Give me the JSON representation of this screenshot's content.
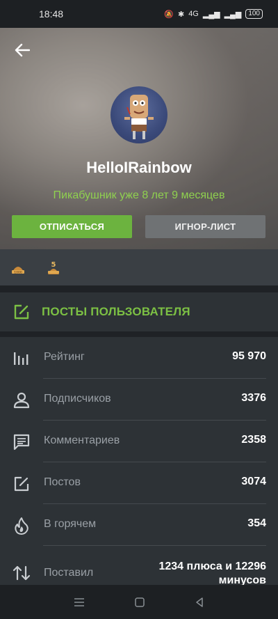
{
  "status": {
    "time": "18:48",
    "network": "4G",
    "battery": "100"
  },
  "profile": {
    "username": "HelloIRainbow",
    "tenure": "Пикабушник уже 8 лет 9 месяцев",
    "unsubscribe_label": "ОТПИСАТЬСЯ",
    "ignore_label": "ИГНОР-ЛИСТ"
  },
  "awards": [
    {
      "icon": "award-1000-icon"
    },
    {
      "icon": "award-5-years-icon"
    }
  ],
  "posts_link": {
    "label": "ПОСТЫ ПОЛЬЗОВАТЕЛЯ",
    "icon": "edit-icon"
  },
  "stats": [
    {
      "label": "Рейтинг",
      "value": "95 970",
      "icon": "rating-bars-icon"
    },
    {
      "label": "Подписчиков",
      "value": "3376",
      "icon": "person-icon"
    },
    {
      "label": "Комментариев",
      "value": "2358",
      "icon": "comment-icon"
    },
    {
      "label": "Постов",
      "value": "3074",
      "icon": "edit-icon"
    },
    {
      "label": "В горячем",
      "value": "354",
      "icon": "flame-icon"
    },
    {
      "label": "Поставил",
      "value_line1": "1234 плюса и 12296",
      "value_line2": "минусов",
      "icon": "sort-arrows-icon"
    }
  ],
  "colors": {
    "accent": "#6cb33f",
    "accent_text": "#7cc044",
    "tenure": "#8fd14f",
    "background": "#2d3236"
  }
}
